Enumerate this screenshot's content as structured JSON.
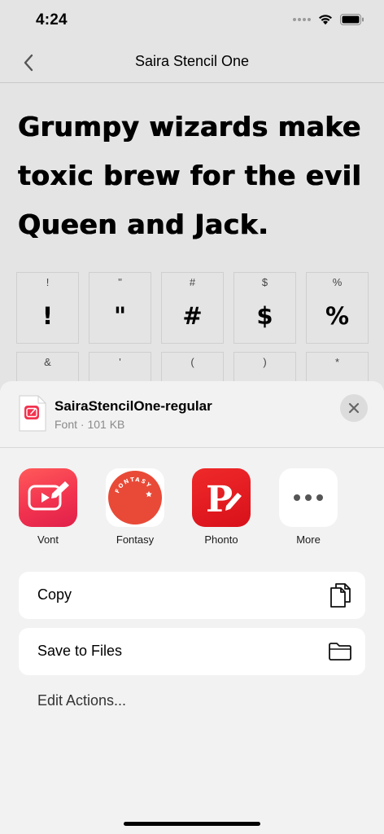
{
  "status": {
    "time": "4:24"
  },
  "nav": {
    "title": "Saira Stencil One"
  },
  "pangram": {
    "text": "Grumpy wizards make toxic brew for the evil Queen and Jack."
  },
  "glyphs": [
    [
      {
        "label": "!",
        "glyph": "!"
      },
      {
        "label": "\"",
        "glyph": "\""
      },
      {
        "label": "#",
        "glyph": "#"
      },
      {
        "label": "$",
        "glyph": "$"
      },
      {
        "label": "%",
        "glyph": "%"
      }
    ],
    [
      {
        "label": "&",
        "glyph": "&"
      },
      {
        "label": "'",
        "glyph": "'"
      },
      {
        "label": "(",
        "glyph": "("
      },
      {
        "label": ")",
        "glyph": ")"
      },
      {
        "label": "*",
        "glyph": "*"
      }
    ]
  ],
  "sheet": {
    "file_name": "SairaStencilOne-regular",
    "file_meta": "Font · 101 KB",
    "apps": [
      {
        "label": "Vont",
        "icon": "vont-app-icon",
        "color": "#f2334f"
      },
      {
        "label": "Fontasy",
        "icon": "fontasy-app-icon",
        "color": "#e84a37"
      },
      {
        "label": "Phonto",
        "icon": "phonto-app-icon",
        "color": "#e3141c"
      },
      {
        "label": "More",
        "icon": "more-icon",
        "color": "#ffffff"
      }
    ],
    "fontasy_badge": "FONTASY",
    "phonto_letter": "P",
    "actions": [
      {
        "label": "Copy",
        "icon": "copy-icon"
      },
      {
        "label": "Save to Files",
        "icon": "folder-icon"
      }
    ],
    "edit_actions": "Edit Actions..."
  }
}
